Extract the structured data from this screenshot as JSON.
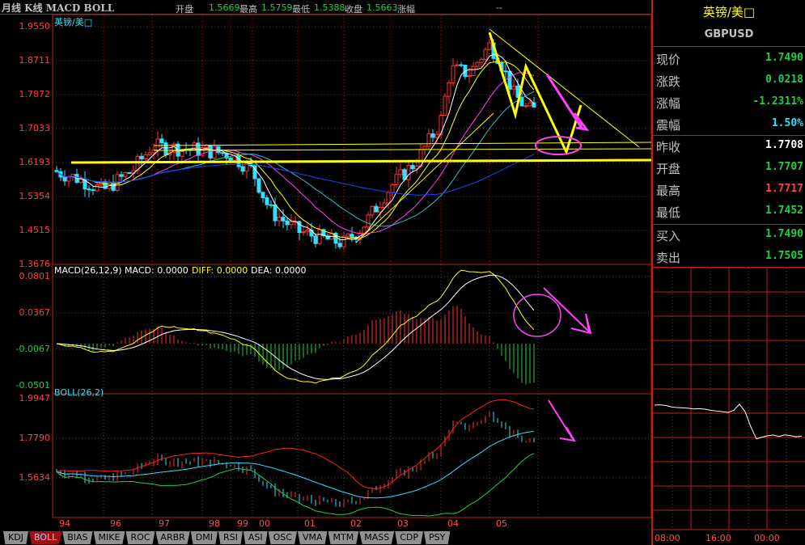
{
  "header": {
    "title": "月线 K线 MACD BOLL",
    "open_label": "开盘",
    "open": "1.5669",
    "high_label": "最高",
    "high": "1.5759",
    "low_label": "最低",
    "low": "1.5388",
    "close_label": "收盘",
    "close": "1.5663",
    "change_label": "涨幅",
    "change": "--"
  },
  "main_panel": {
    "symbol": "英镑/美□",
    "ylabels": [
      "1.9550",
      "1.8711",
      "1.7872",
      "1.7033",
      "1.6193",
      "1.5354",
      "1.4515",
      "1.3676"
    ]
  },
  "macd_panel": {
    "label": "MACD(26,12,9) MACD: 0.0000",
    "diff": "DIFF: 0.0000",
    "dea": "DEA: 0.0000",
    "ylabels": [
      "0.0801",
      "0.0367",
      "-0.0067",
      "-0.0501"
    ]
  },
  "boll_panel": {
    "label": "BOLL(26,2)",
    "ylabels": [
      "1.9947",
      "1.7790",
      "1.5634"
    ]
  },
  "xlabels": [
    "94",
    "96",
    "97",
    "98",
    "99",
    "00",
    "01",
    "02",
    "03",
    "04",
    "05"
  ],
  "tabs": [
    "KDJ",
    "BOLL",
    "BIAS",
    "MIKE",
    "ROC",
    "ARBR",
    "DMI",
    "RSI",
    "ASI",
    "OSC",
    "VMA",
    "MTM",
    "MASS",
    "CDP",
    "PSY"
  ],
  "active_tab": "BOLL",
  "quote": {
    "name": "英镑/美□",
    "code": "GBPUSD",
    "rows": [
      {
        "k": "现价",
        "v": "1.7490",
        "c": "#20d040"
      },
      {
        "k": "涨跌",
        "v": "0.0218",
        "c": "#20d040"
      },
      {
        "k": "涨幅",
        "v": "-1.2311%",
        "c": "#20d040"
      },
      {
        "k": "震幅",
        "v": "1.50%",
        "c": "#30e0ff"
      },
      {
        "k": "昨收",
        "v": "1.7708",
        "c": "#ffffff"
      },
      {
        "k": "开盘",
        "v": "1.7707",
        "c": "#20d040"
      },
      {
        "k": "最高",
        "v": "1.7717",
        "c": "#ff4040"
      },
      {
        "k": "最低",
        "v": "1.7452",
        "c": "#20d040"
      },
      {
        "k": "买入",
        "v": "1.7490",
        "c": "#20d040"
      },
      {
        "k": "卖出",
        "v": "1.7505",
        "c": "#20d040"
      }
    ]
  },
  "intraday": {
    "times": [
      "08:00",
      "16:00",
      "00:00"
    ],
    "prices": [
      1.7708,
      1.771,
      1.7705,
      1.7695,
      1.769,
      1.7688,
      1.7685,
      1.768,
      1.7682,
      1.7678,
      1.767,
      1.7665,
      1.766,
      1.7655,
      1.767,
      1.7715,
      1.766,
      1.755,
      1.7462,
      1.7475,
      1.7485,
      1.749,
      1.748,
      1.7492,
      1.7486,
      1.7478,
      1.7482
    ]
  },
  "chart_data": {
    "type": "candlestick",
    "title": "GBPUSD monthly",
    "ylim": [
      1.3676,
      1.955
    ],
    "anchors": [
      [
        1994.0,
        1.6
      ],
      [
        1995.0,
        1.58
      ],
      [
        1996.0,
        1.55
      ],
      [
        1996.6,
        1.6
      ],
      [
        1997.0,
        1.66
      ],
      [
        1998.0,
        1.65
      ],
      [
        1999.0,
        1.64
      ],
      [
        2000.0,
        1.6
      ],
      [
        2000.4,
        1.5
      ],
      [
        2001.0,
        1.45
      ],
      [
        2001.6,
        1.43
      ],
      [
        2002.0,
        1.42
      ],
      [
        2002.4,
        1.46
      ],
      [
        2003.0,
        1.56
      ],
      [
        2003.5,
        1.62
      ],
      [
        2004.0,
        1.72
      ],
      [
        2004.2,
        1.85
      ],
      [
        2004.6,
        1.84
      ],
      [
        2005.0,
        1.91
      ],
      [
        2005.2,
        1.88
      ],
      [
        2005.5,
        1.79
      ],
      [
        2005.8,
        1.749
      ]
    ]
  }
}
